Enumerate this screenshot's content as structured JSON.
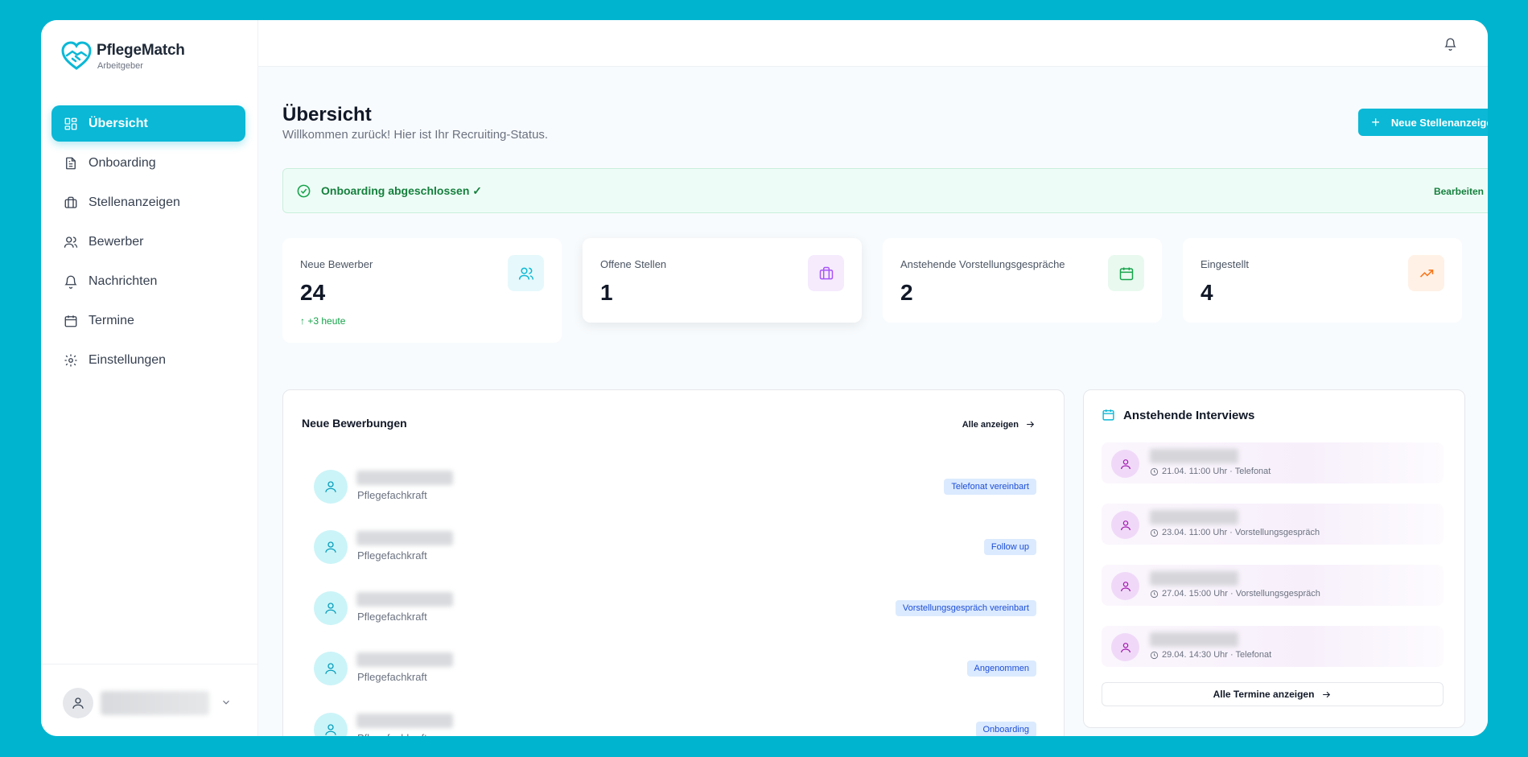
{
  "brand": {
    "name": "PflegeMatch",
    "subtitle": "Arbeitgeber",
    "accent": "#0bb8d6"
  },
  "sidebar": {
    "items": [
      {
        "label": "Übersicht",
        "icon": "dashboard-icon",
        "active": true
      },
      {
        "label": "Onboarding",
        "icon": "document-icon"
      },
      {
        "label": "Stellenanzeigen",
        "icon": "briefcase-icon"
      },
      {
        "label": "Bewerber",
        "icon": "users-icon"
      },
      {
        "label": "Nachrichten",
        "icon": "bell-icon"
      },
      {
        "label": "Termine",
        "icon": "calendar-icon"
      },
      {
        "label": "Einstellungen",
        "icon": "gear-icon"
      }
    ]
  },
  "header": {
    "title": "Übersicht",
    "subtitle": "Willkommen zurück! Hier ist Ihr Recruiting-Status.",
    "new_job_label": "Neue Stellenanzeige"
  },
  "banner": {
    "text": "Onboarding abgeschlossen ✓",
    "edit_label": "Bearbeiten"
  },
  "stats": [
    {
      "label": "Neue Bewerber",
      "value": "24",
      "trend": "↑ +3 heute",
      "icon": "users-icon",
      "color": "#0bb8d6"
    },
    {
      "label": "Offene Stellen",
      "value": "1",
      "icon": "briefcase-icon",
      "color": "#a855f7"
    },
    {
      "label": "Anstehende Vorstellungsgespräche",
      "value": "2",
      "icon": "calendar-icon",
      "color": "#16a34a"
    },
    {
      "label": "Eingestellt",
      "value": "4",
      "icon": "trending-up-icon",
      "color": "#f97316"
    }
  ],
  "applications": {
    "title": "Neue Bewerbungen",
    "view_all_label": "Alle anzeigen",
    "rows": [
      {
        "role": "Pflegefachkraft",
        "status": "Telefonat vereinbart"
      },
      {
        "role": "Pflegefachkraft",
        "status": "Follow up"
      },
      {
        "role": "Pflegefachkraft",
        "status": "Vorstellungsgespräch vereinbart"
      },
      {
        "role": "Pflegefachkraft",
        "status": "Angenommen"
      },
      {
        "role": "Pflegefachkraft",
        "status": "Onboarding"
      }
    ]
  },
  "interviews": {
    "title": "Anstehende Interviews",
    "all_label": "Alle Termine anzeigen",
    "rows": [
      {
        "meta": "21.04. 11:00 Uhr · Telefonat"
      },
      {
        "meta": "23.04. 11:00 Uhr · Vorstellungsgespräch"
      },
      {
        "meta": "27.04. 15:00 Uhr · Vorstellungsgespräch"
      },
      {
        "meta": "29.04. 14:30 Uhr · Telefonat"
      }
    ]
  }
}
